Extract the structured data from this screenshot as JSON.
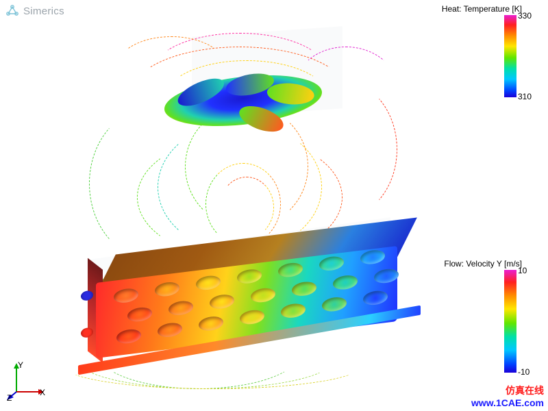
{
  "brand": {
    "name": "Simerics"
  },
  "axes": {
    "x": "X",
    "y": "Y",
    "z": "Z"
  },
  "legends": {
    "heat": {
      "title": "Heat: Temperature [K]",
      "max": "330",
      "min": "310"
    },
    "flow": {
      "title": "Flow: Velocity Y [m/s]",
      "max": "10",
      "min": "-10"
    }
  },
  "watermark": {
    "line1": "仿真在线",
    "line2": "www.1CAE.com"
  },
  "legend_colormap": "rainbow",
  "chart_data": {
    "type": "cfd-3d-visualization",
    "scalars": [
      {
        "name": "Heat: Temperature",
        "unit": "K",
        "range": [
          310,
          330
        ]
      },
      {
        "name": "Flow: Velocity Y",
        "unit": "m/s",
        "range": [
          -10,
          10
        ]
      }
    ],
    "geometry": [
      "fan-impeller",
      "finned-heatsink",
      "enclosure"
    ],
    "render": [
      "streamlines",
      "surface-contour"
    ],
    "colormap": "rainbow",
    "coord_axes": [
      "X",
      "Y",
      "Z"
    ]
  }
}
